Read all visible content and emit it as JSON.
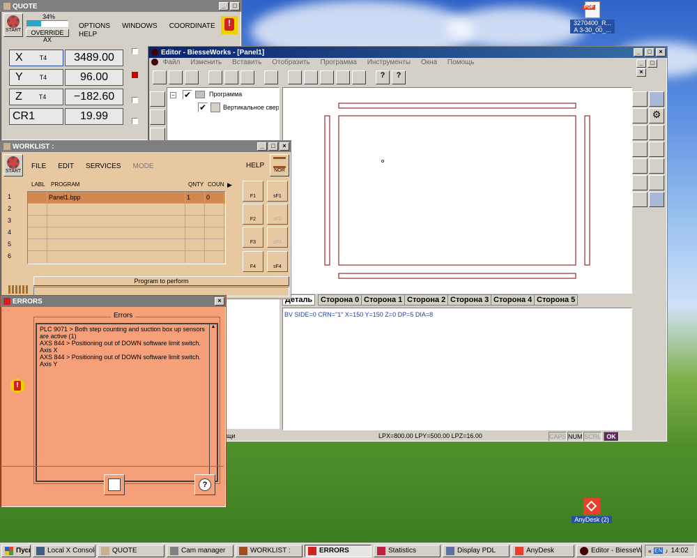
{
  "desktop": {
    "pdf_icon": {
      "label_line1": "3270400_R...",
      "label_line2": "A 3-30_00_..."
    },
    "anydesk_icon": {
      "label": "AnyDesk (2)"
    }
  },
  "quote": {
    "title": "QUOTE",
    "start_label": "START",
    "percent": "34%",
    "progress": 0.34,
    "override_label": "OVERRIDE AX",
    "menu": [
      "OPTIONS",
      "WINDOWS",
      "COORDINATE",
      "HELP"
    ],
    "axes": [
      {
        "name": "X",
        "tool": "T4",
        "value": "3489.00"
      },
      {
        "name": "Y",
        "tool": "T4",
        "value": "96.00"
      },
      {
        "name": "Z",
        "tool": "T4",
        "value": "−182.60"
      },
      {
        "name": "CR1",
        "tool": "",
        "value": "19.99"
      }
    ]
  },
  "worklist": {
    "title": "WORKLIST :",
    "start_label": "START",
    "menu": [
      "FILE",
      "EDIT",
      "SERVICES",
      "MODE"
    ],
    "help": "HELP",
    "nor_label": "NOR",
    "headers": {
      "labl": "LABL",
      "program": "PROGRAM",
      "qnty": "QNTY",
      "coun": "COUN"
    },
    "rows": [
      {
        "num": "1",
        "program": "Panel1.bpp",
        "qnty": "1",
        "coun": "0"
      },
      {
        "num": "2",
        "program": "",
        "qnty": "",
        "coun": ""
      },
      {
        "num": "3",
        "program": "",
        "qnty": "",
        "coun": ""
      },
      {
        "num": "4",
        "program": "",
        "qnty": "",
        "coun": ""
      },
      {
        "num": "5",
        "program": "",
        "qnty": "",
        "coun": ""
      },
      {
        "num": "6",
        "program": "",
        "qnty": "",
        "coun": ""
      }
    ],
    "fkeys": [
      "F1",
      "sF1",
      "F2",
      "sF2",
      "F3",
      "sF3",
      "F4",
      "sF4"
    ],
    "program_to_perform": "Program to perform"
  },
  "errors": {
    "title": "ERRORS",
    "group_label": "Errors",
    "lines": [
      "PLC 9071 >   Both step counting and suction box up sensors are active  (1)",
      "AXS 844 >   Positioning out of DOWN software limit switch. Axis X",
      "AXS 844 >   Positioning out of DOWN software limit switch. Axis Y"
    ]
  },
  "editor": {
    "title": "Editor - BiesseWorks - [Panel1]",
    "menu": [
      "Файл",
      "Изменить",
      "Вставить",
      "Отобразить",
      "Программа",
      "Инструменты",
      "Окна",
      "Помощь"
    ],
    "tree": {
      "root": "Программа",
      "child": "Вертикальное свер"
    },
    "tabs": [
      "Деталь",
      "Сторона 0",
      "Сторона 1",
      "Сторона 2",
      "Сторона 3",
      "Сторона 4",
      "Сторона 5"
    ],
    "code_line": "BV SIDE=0 CRN=\"1\" X=150 Y=150 Z=0 DP=5 DIA=8",
    "left_status": "щи",
    "status": "LPX=800.00  LPY=500.00  LPZ=16.00",
    "caps": "CAPS",
    "num": "NUM",
    "scrl": "SCRL",
    "ok": "OK"
  },
  "taskbar": {
    "start": "Пуск",
    "tasks": [
      "Local X Console",
      "QUOTE",
      "Cam manager",
      "WORKLIST :",
      "ERRORS",
      "Statistics",
      "Display PDL",
      "AnyDesk",
      "Editor - BiesseW..."
    ],
    "active_task": "ERRORS",
    "lang": "EN",
    "clock": "14:02"
  },
  "colors": {
    "salmon": "#f6a07a",
    "worklist_bg": "#e8c8a0",
    "row_highlight": "#d08850",
    "titlebar_active": "#0a246a"
  }
}
